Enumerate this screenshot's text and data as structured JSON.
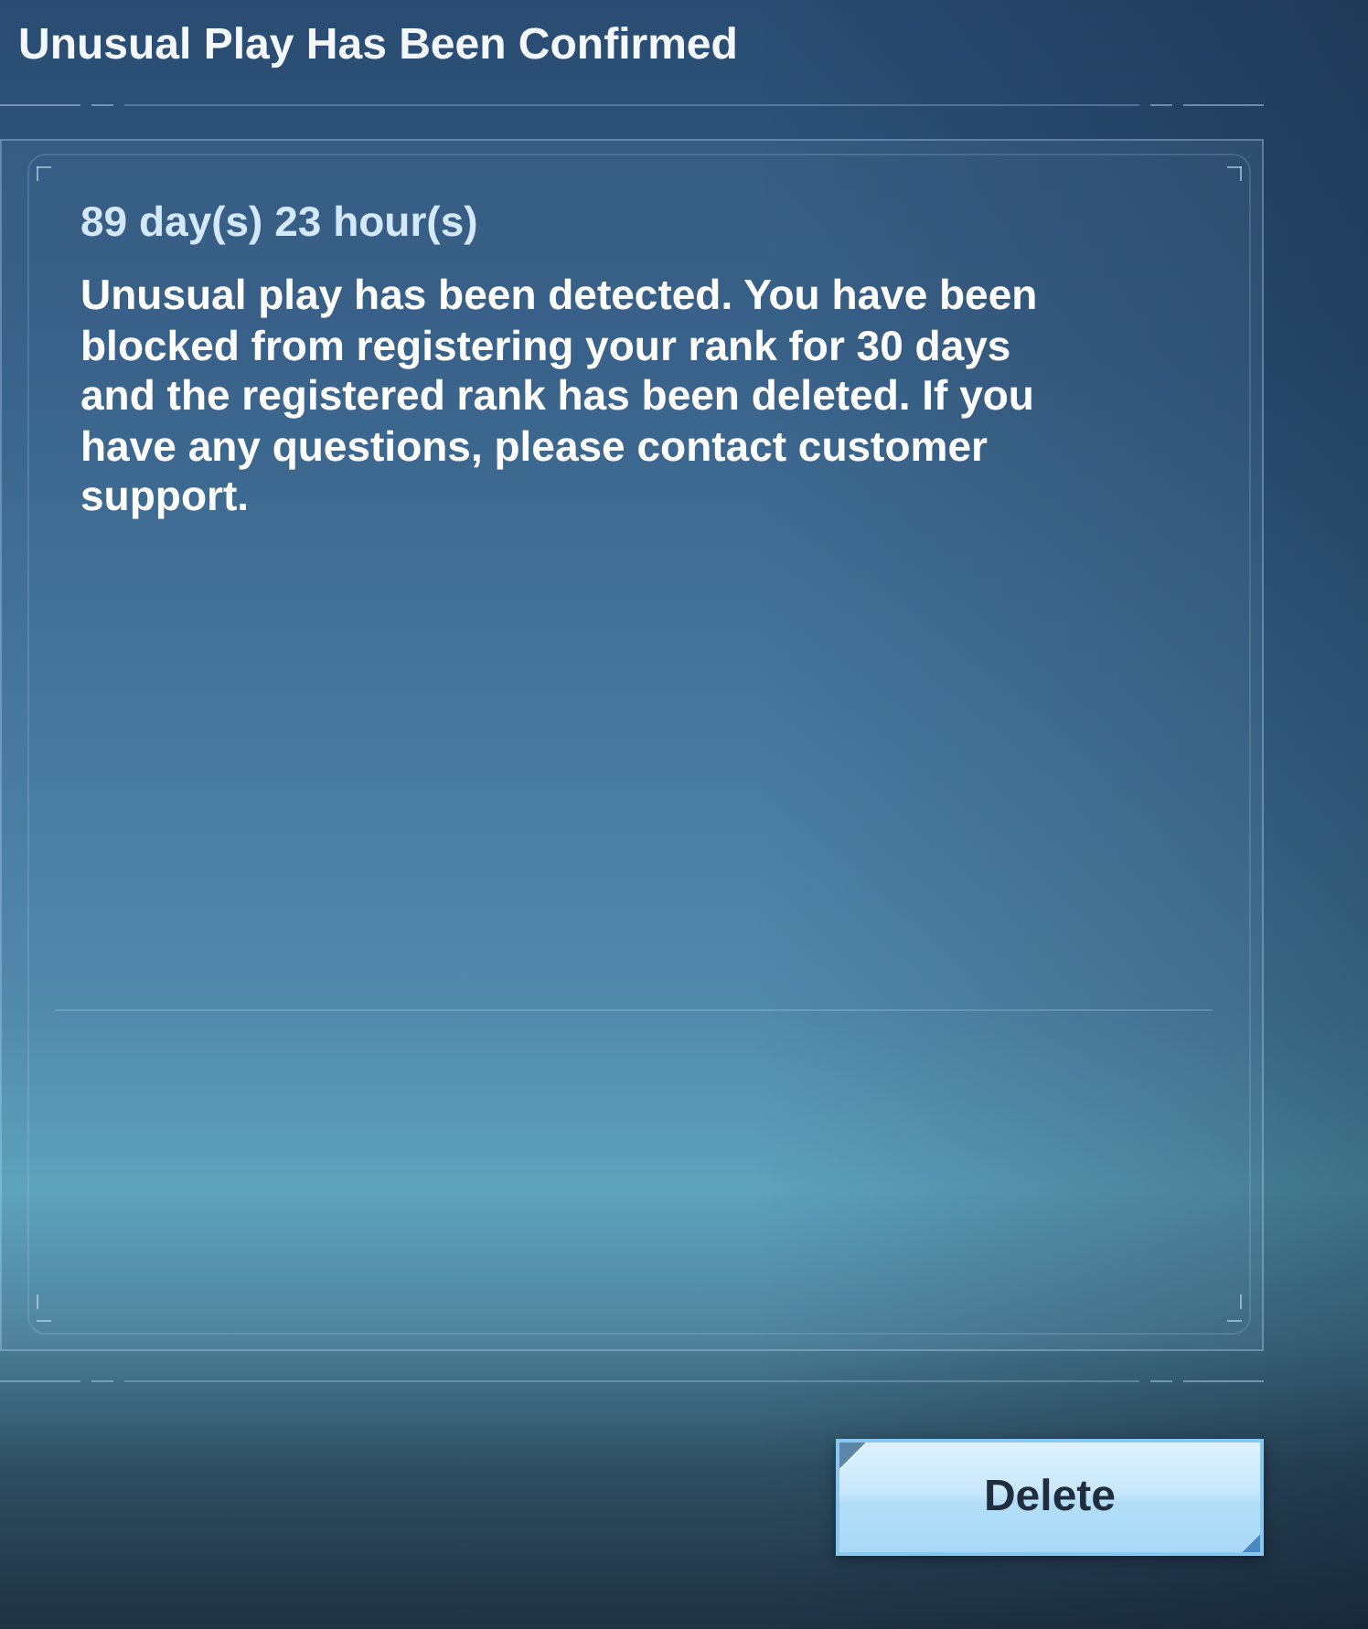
{
  "title": "Unusual Play Has Been Confirmed",
  "notice": {
    "timer": "89 day(s) 23 hour(s)",
    "message": "Unusual play has been detected. You have been blocked from registering your rank for 30 days and the registered rank has been deleted. If you have any questions, please contact customer support."
  },
  "buttons": [
    {
      "label": "Delete"
    }
  ]
}
